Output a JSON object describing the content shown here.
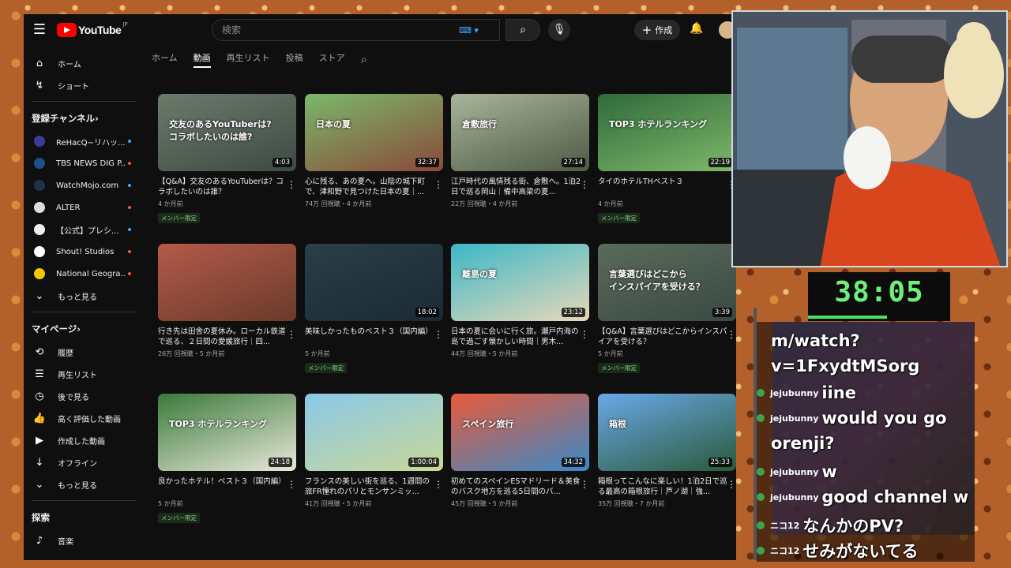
{
  "header": {
    "logo": "YouTube",
    "region": "JP",
    "search_placeholder": "検索",
    "create_label": "作成"
  },
  "sidebar": {
    "main": [
      {
        "label": "ホーム",
        "icon": "home-icon"
      },
      {
        "label": "ショート",
        "icon": "shorts-icon"
      }
    ],
    "subscriptions_title": "登録チャンネル",
    "channels": [
      {
        "label": "ReHacQ−リハッ...",
        "color": "#3b3b9a",
        "live": "#3ea6ff"
      },
      {
        "label": "TBS NEWS DIG P...",
        "color": "#1e4f8c",
        "live": "#ff4e45"
      },
      {
        "label": "WatchMojo.com",
        "color": "#20324a",
        "live": "#3ea6ff"
      },
      {
        "label": "ALTER",
        "color": "#dddddd",
        "live": "#ff4e45"
      },
      {
        "label": "【公式】プレシ...",
        "color": "#eeeeee",
        "live": "#3ea6ff"
      },
      {
        "label": "Shout! Studios",
        "color": "#ffffff",
        "live": "#ff4e45"
      },
      {
        "label": "National Geogra...",
        "color": "#f6c700",
        "live": "#ff4e45"
      }
    ],
    "subs_more": "もっと見る",
    "mypage_title": "マイページ",
    "mypage": [
      {
        "label": "履歴",
        "icon": "history-icon"
      },
      {
        "label": "再生リスト",
        "icon": "playlist-icon"
      },
      {
        "label": "後で見る",
        "icon": "watch-later-icon"
      },
      {
        "label": "高く評価した動画",
        "icon": "like-icon"
      },
      {
        "label": "作成した動画",
        "icon": "your-videos-icon"
      },
      {
        "label": "オフライン",
        "icon": "download-icon"
      },
      {
        "label": "もっと見る",
        "icon": "chevron-down-icon"
      }
    ],
    "explore_title": "探索",
    "explore": [
      {
        "label": "音楽",
        "icon": "music-icon"
      }
    ]
  },
  "tabs": [
    "ホーム",
    "動画",
    "再生リスト",
    "投稿",
    "ストア"
  ],
  "member_label": "メンバー限定",
  "videos": [
    {
      "title": "【Q&A】交友のあるYouTuberは？コラボしたいのは誰？",
      "meta": "4 か月前",
      "duration": "4:03",
      "member": true,
      "overlay": "交友のあるYouTuberは?\nコラボしたいのは誰?",
      "c1": "#6b7b6a",
      "c2": "#3d4a44"
    },
    {
      "title": "心に残る、あの夏へ。山陰の城下町で、津和野で見つけた日本の夏｜...",
      "meta": "74万 回視聴・4 か月前",
      "duration": "32:37",
      "member": false,
      "overlay": "日本の夏",
      "c1": "#7ab86a",
      "c2": "#8a4a3a"
    },
    {
      "title": "江戸時代の風情残る街、倉敷へ。1泊2日で巡る岡山｜備中高梁の夏...",
      "meta": "22万 回視聴・4 か月前",
      "duration": "27:14",
      "member": false,
      "overlay": "倉敷旅行",
      "c1": "#a7b59a",
      "c2": "#4e5a44"
    },
    {
      "title": "タイのホテルTHベスト３",
      "meta": "4 か月前",
      "duration": "22:19",
      "member": true,
      "overlay": "TOP3 ホテルランキング",
      "c1": "#2f6a3a",
      "c2": "#7fb86a"
    },
    {
      "title": "行き先は田舎の夏休み。ローカル鉄道で巡る、２日間の愛媛旅行｜四...",
      "meta": "26万 回視聴・5 か月前",
      "duration": "",
      "member": false,
      "overlay": "",
      "c1": "#b45a4a",
      "c2": "#6a3a2a"
    },
    {
      "title": "美味しかったものベスト３（国内編）",
      "meta": "5 か月前",
      "duration": "18:02",
      "member": true,
      "overlay": "",
      "c1": "#2a3f4a",
      "c2": "#1a2a33"
    },
    {
      "title": "日本の夏に会いに行く旅。瀬戸内海の島で過ごす懐かしい時間｜男木...",
      "meta": "44万 回視聴・5 か月前",
      "duration": "23:12",
      "member": false,
      "overlay": "離島の夏",
      "c1": "#3ab8c8",
      "c2": "#e8d8b8"
    },
    {
      "title": "【Q&A】言葉選びはどこからインスパイアを受ける？",
      "meta": "5 か月前",
      "duration": "3:39",
      "member": true,
      "overlay": "言葉選びはどこから\nインスパイアを受ける？",
      "c1": "#5a6a5a",
      "c2": "#3a4a44"
    },
    {
      "title": "良かったホテル！ベスト３（国内編）",
      "meta": "5 か月前",
      "duration": "24:18",
      "member": true,
      "overlay": "TOP3 ホテルランキング",
      "c1": "#3a7a3a",
      "c2": "#e8e8d8"
    },
    {
      "title": "フランスの美しい街を巡る、1週間の旅FR憧れのパリとモンサンミッ...",
      "meta": "41万 回視聴・5 か月前",
      "duration": "1:00:04",
      "member": false,
      "overlay": "",
      "c1": "#8ac8e8",
      "c2": "#c8d898"
    },
    {
      "title": "初めてのスペインESマドリード＆美食のバスク地方を巡る5日間のバ...",
      "meta": "45万 回視聴・5 か月前",
      "duration": "34:32",
      "member": false,
      "overlay": "スペイン旅行",
      "c1": "#e85a3a",
      "c2": "#3a8ac8"
    },
    {
      "title": "箱根ってこんなに楽しい！1泊2日で巡る最高の箱根旅行｜芦ノ湖｜強...",
      "meta": "35万 回視聴・7 か月前",
      "duration": "25:33",
      "member": false,
      "overlay": "箱根",
      "c1": "#6aa8e8",
      "c2": "#2a5a3a"
    }
  ],
  "overlay": {
    "timer": "38:05"
  },
  "chat": [
    {
      "user": "",
      "text": "m/watch?"
    },
    {
      "user": "",
      "text": "v=1FxydtMSorg"
    },
    {
      "user": "jejubunny",
      "text": "iine"
    },
    {
      "user": "jejubunny",
      "text": "would you go"
    },
    {
      "user": "",
      "text": "orenji?"
    },
    {
      "user": "jejubunny",
      "text": "w"
    },
    {
      "user": "jejubunny",
      "text": "good channel w"
    },
    {
      "user": "ニコ12",
      "text": "なんかのPV?"
    },
    {
      "user": "ニコ12",
      "text": "せみがないてる"
    }
  ]
}
